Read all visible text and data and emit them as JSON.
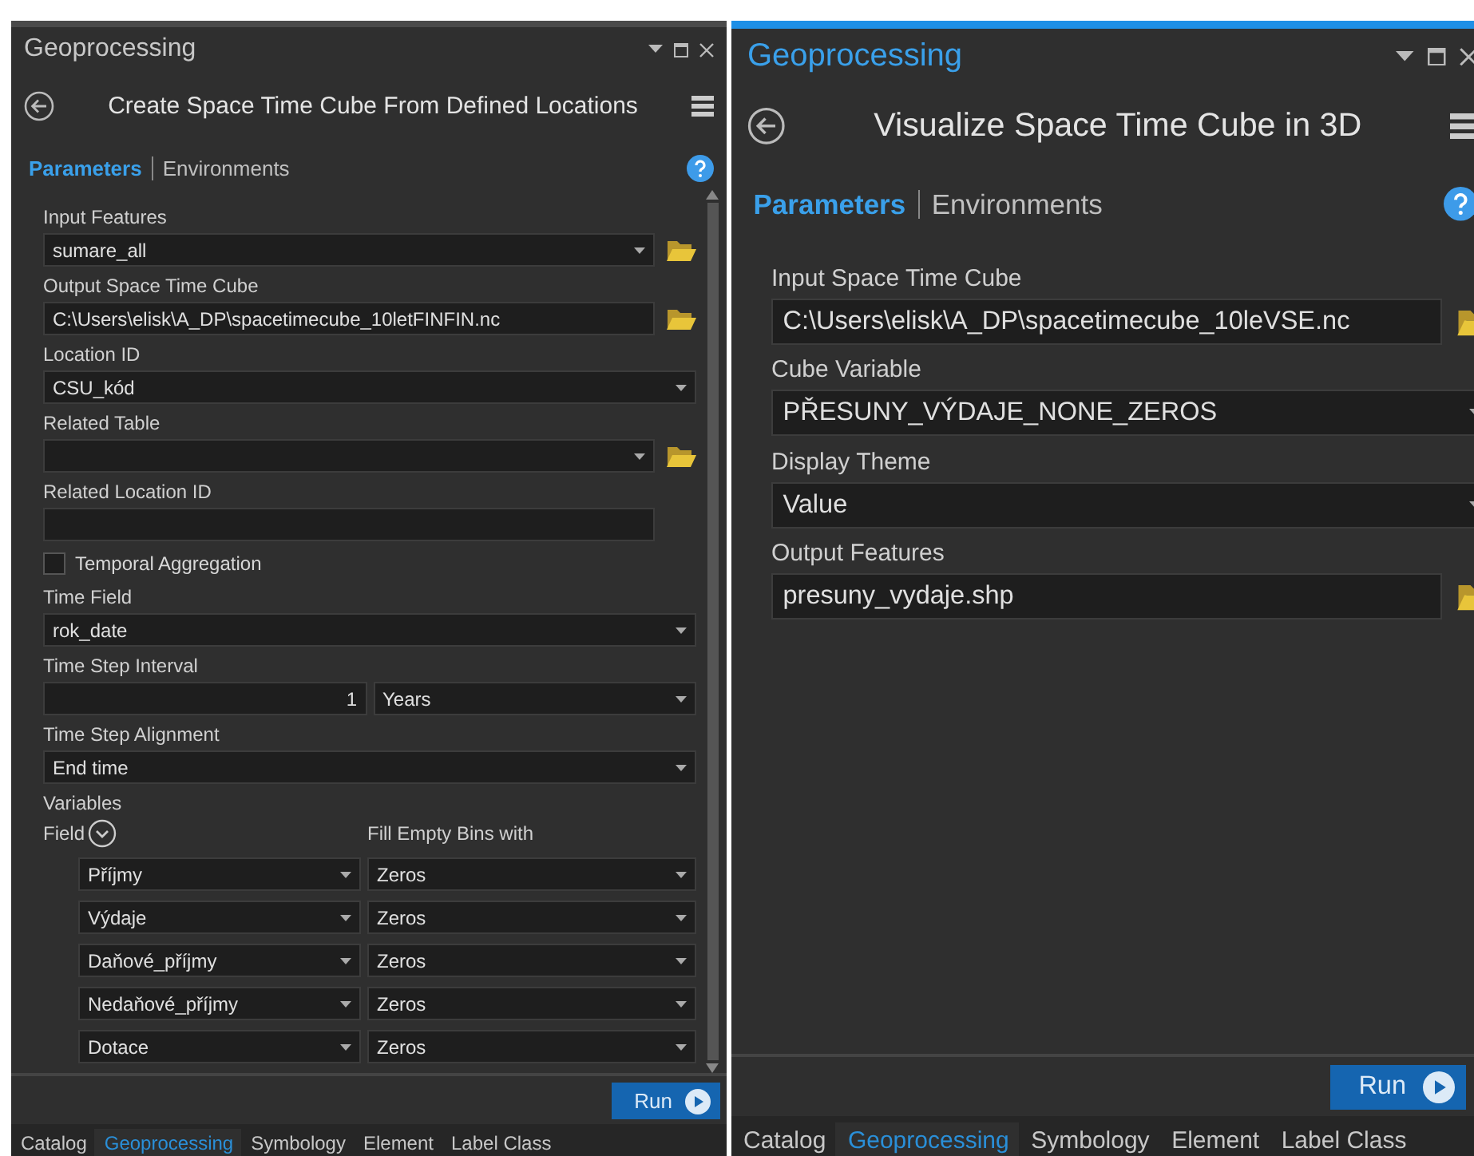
{
  "panels": [
    {
      "title": "Geoprocessing",
      "active": false,
      "tool": "Create Space Time Cube From Defined Locations",
      "scrollbar": true,
      "tabs": [
        {
          "label": "Parameters",
          "selected": true
        },
        {
          "label": "Environments",
          "selected": false
        }
      ],
      "params": [
        {
          "kind": "dropdown",
          "label": "Input Features",
          "value": "sumare_all",
          "browse": true
        },
        {
          "kind": "text",
          "label": "Output Space Time Cube",
          "value": "C:\\Users\\elisk\\A_DP\\spacetimecube_10letFINFIN.nc",
          "browse": true
        },
        {
          "kind": "dropdown",
          "label": "Location ID",
          "value": "CSU_kód",
          "browse": false
        },
        {
          "kind": "dropdown",
          "label": "Related Table",
          "browse": true
        },
        {
          "kind": "text",
          "label": "Related Location ID",
          "browse": false
        },
        {
          "kind": "checkbox",
          "label": "Temporal Aggregation",
          "checked": false
        },
        {
          "kind": "dropdown",
          "label": "Time Field",
          "value": "rok_date",
          "browse": false
        },
        {
          "kind": "interval",
          "label": "Time Step Interval",
          "value": "1",
          "unit": "Years"
        },
        {
          "kind": "dropdown",
          "label": "Time Step Alignment",
          "value": "End time",
          "browse": false
        },
        {
          "kind": "variables",
          "label": "Variables",
          "field_header": "Field",
          "fill_header": "Fill Empty Bins with",
          "rows": [
            {
              "field": "Příjmy",
              "fill": "Zeros"
            },
            {
              "field": "Výdaje",
              "fill": "Zeros"
            },
            {
              "field": "Daňové_příjmy",
              "fill": "Zeros"
            },
            {
              "field": "Nedaňové_příjmy",
              "fill": "Zeros"
            },
            {
              "field": "Dotace",
              "fill": "Zeros"
            }
          ]
        }
      ],
      "run": "Run",
      "bottom_tabs": [
        {
          "label": "Catalog",
          "selected": false
        },
        {
          "label": "Geoprocessing",
          "selected": true
        },
        {
          "label": "Symbology",
          "selected": false
        },
        {
          "label": "Element",
          "selected": false
        },
        {
          "label": "Label Class",
          "selected": false
        }
      ]
    },
    {
      "title": "Geoprocessing",
      "active": true,
      "tool": "Visualize Space Time Cube in 3D",
      "scrollbar": false,
      "tabs": [
        {
          "label": "Parameters",
          "selected": true
        },
        {
          "label": "Environments",
          "selected": false
        }
      ],
      "params": [
        {
          "kind": "text",
          "label": "Input Space Time Cube",
          "value": "C:\\Users\\elisk\\A_DP\\spacetimecube_10leVSE.nc",
          "browse": true
        },
        {
          "kind": "dropdown",
          "label": "Cube Variable",
          "value": "PŘESUNY_VÝDAJE_NONE_ZEROS",
          "browse": false
        },
        {
          "kind": "dropdown",
          "label": "Display Theme",
          "value": "Value",
          "browse": false
        },
        {
          "kind": "text",
          "label": "Output Features",
          "value": "presuny_vydaje.shp",
          "browse": true
        }
      ],
      "run": "Run",
      "bottom_tabs": [
        {
          "label": "Catalog",
          "selected": false
        },
        {
          "label": "Geoprocessing",
          "selected": true
        },
        {
          "label": "Symbology",
          "selected": false
        },
        {
          "label": "Element",
          "selected": false
        },
        {
          "label": "Label Class",
          "selected": false
        }
      ]
    }
  ]
}
